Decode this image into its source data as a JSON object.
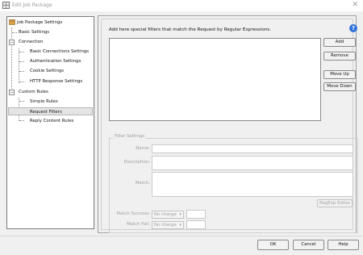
{
  "window": {
    "title": "Edit Job Package",
    "close_glyph": "✕",
    "icon": "package-icon"
  },
  "tree": {
    "items": [
      {
        "label": "Job Package Settings",
        "icon": "package-icon"
      },
      {
        "label": "Basic Settings"
      },
      {
        "label": "Connection",
        "toggle": "−"
      },
      {
        "label": "Basic Connections Settings"
      },
      {
        "label": "Authentication Settings"
      },
      {
        "label": "Cookie Settings"
      },
      {
        "label": "HTTP Response Settings"
      },
      {
        "label": "Custom Rules",
        "toggle": "−"
      },
      {
        "label": "Simple Rules"
      },
      {
        "label": "Request Filters",
        "selected": true
      },
      {
        "label": "Reply Content Rules"
      }
    ]
  },
  "panel": {
    "description": "Add here special filters that match the Request by Regular Expressions.",
    "help_glyph": "?",
    "buttons": {
      "add": "Add",
      "remove": "Remove",
      "move_up": "Move Up",
      "move_down": "Move Down"
    },
    "filter_settings": {
      "legend": "Filter Settings",
      "name_label": "Name:",
      "name_value": "",
      "description_label": "Description:",
      "description_value": "",
      "match_label": "Match:",
      "match_value": "",
      "regexp_editor": "RegExp Editor",
      "match_success_label": "Match Success:",
      "match_success_value": "No change",
      "match_fail_label": "Match Fail:",
      "match_fail_value": "No change"
    }
  },
  "footer": {
    "ok": "OK",
    "cancel": "Cancel",
    "help": "Help"
  }
}
